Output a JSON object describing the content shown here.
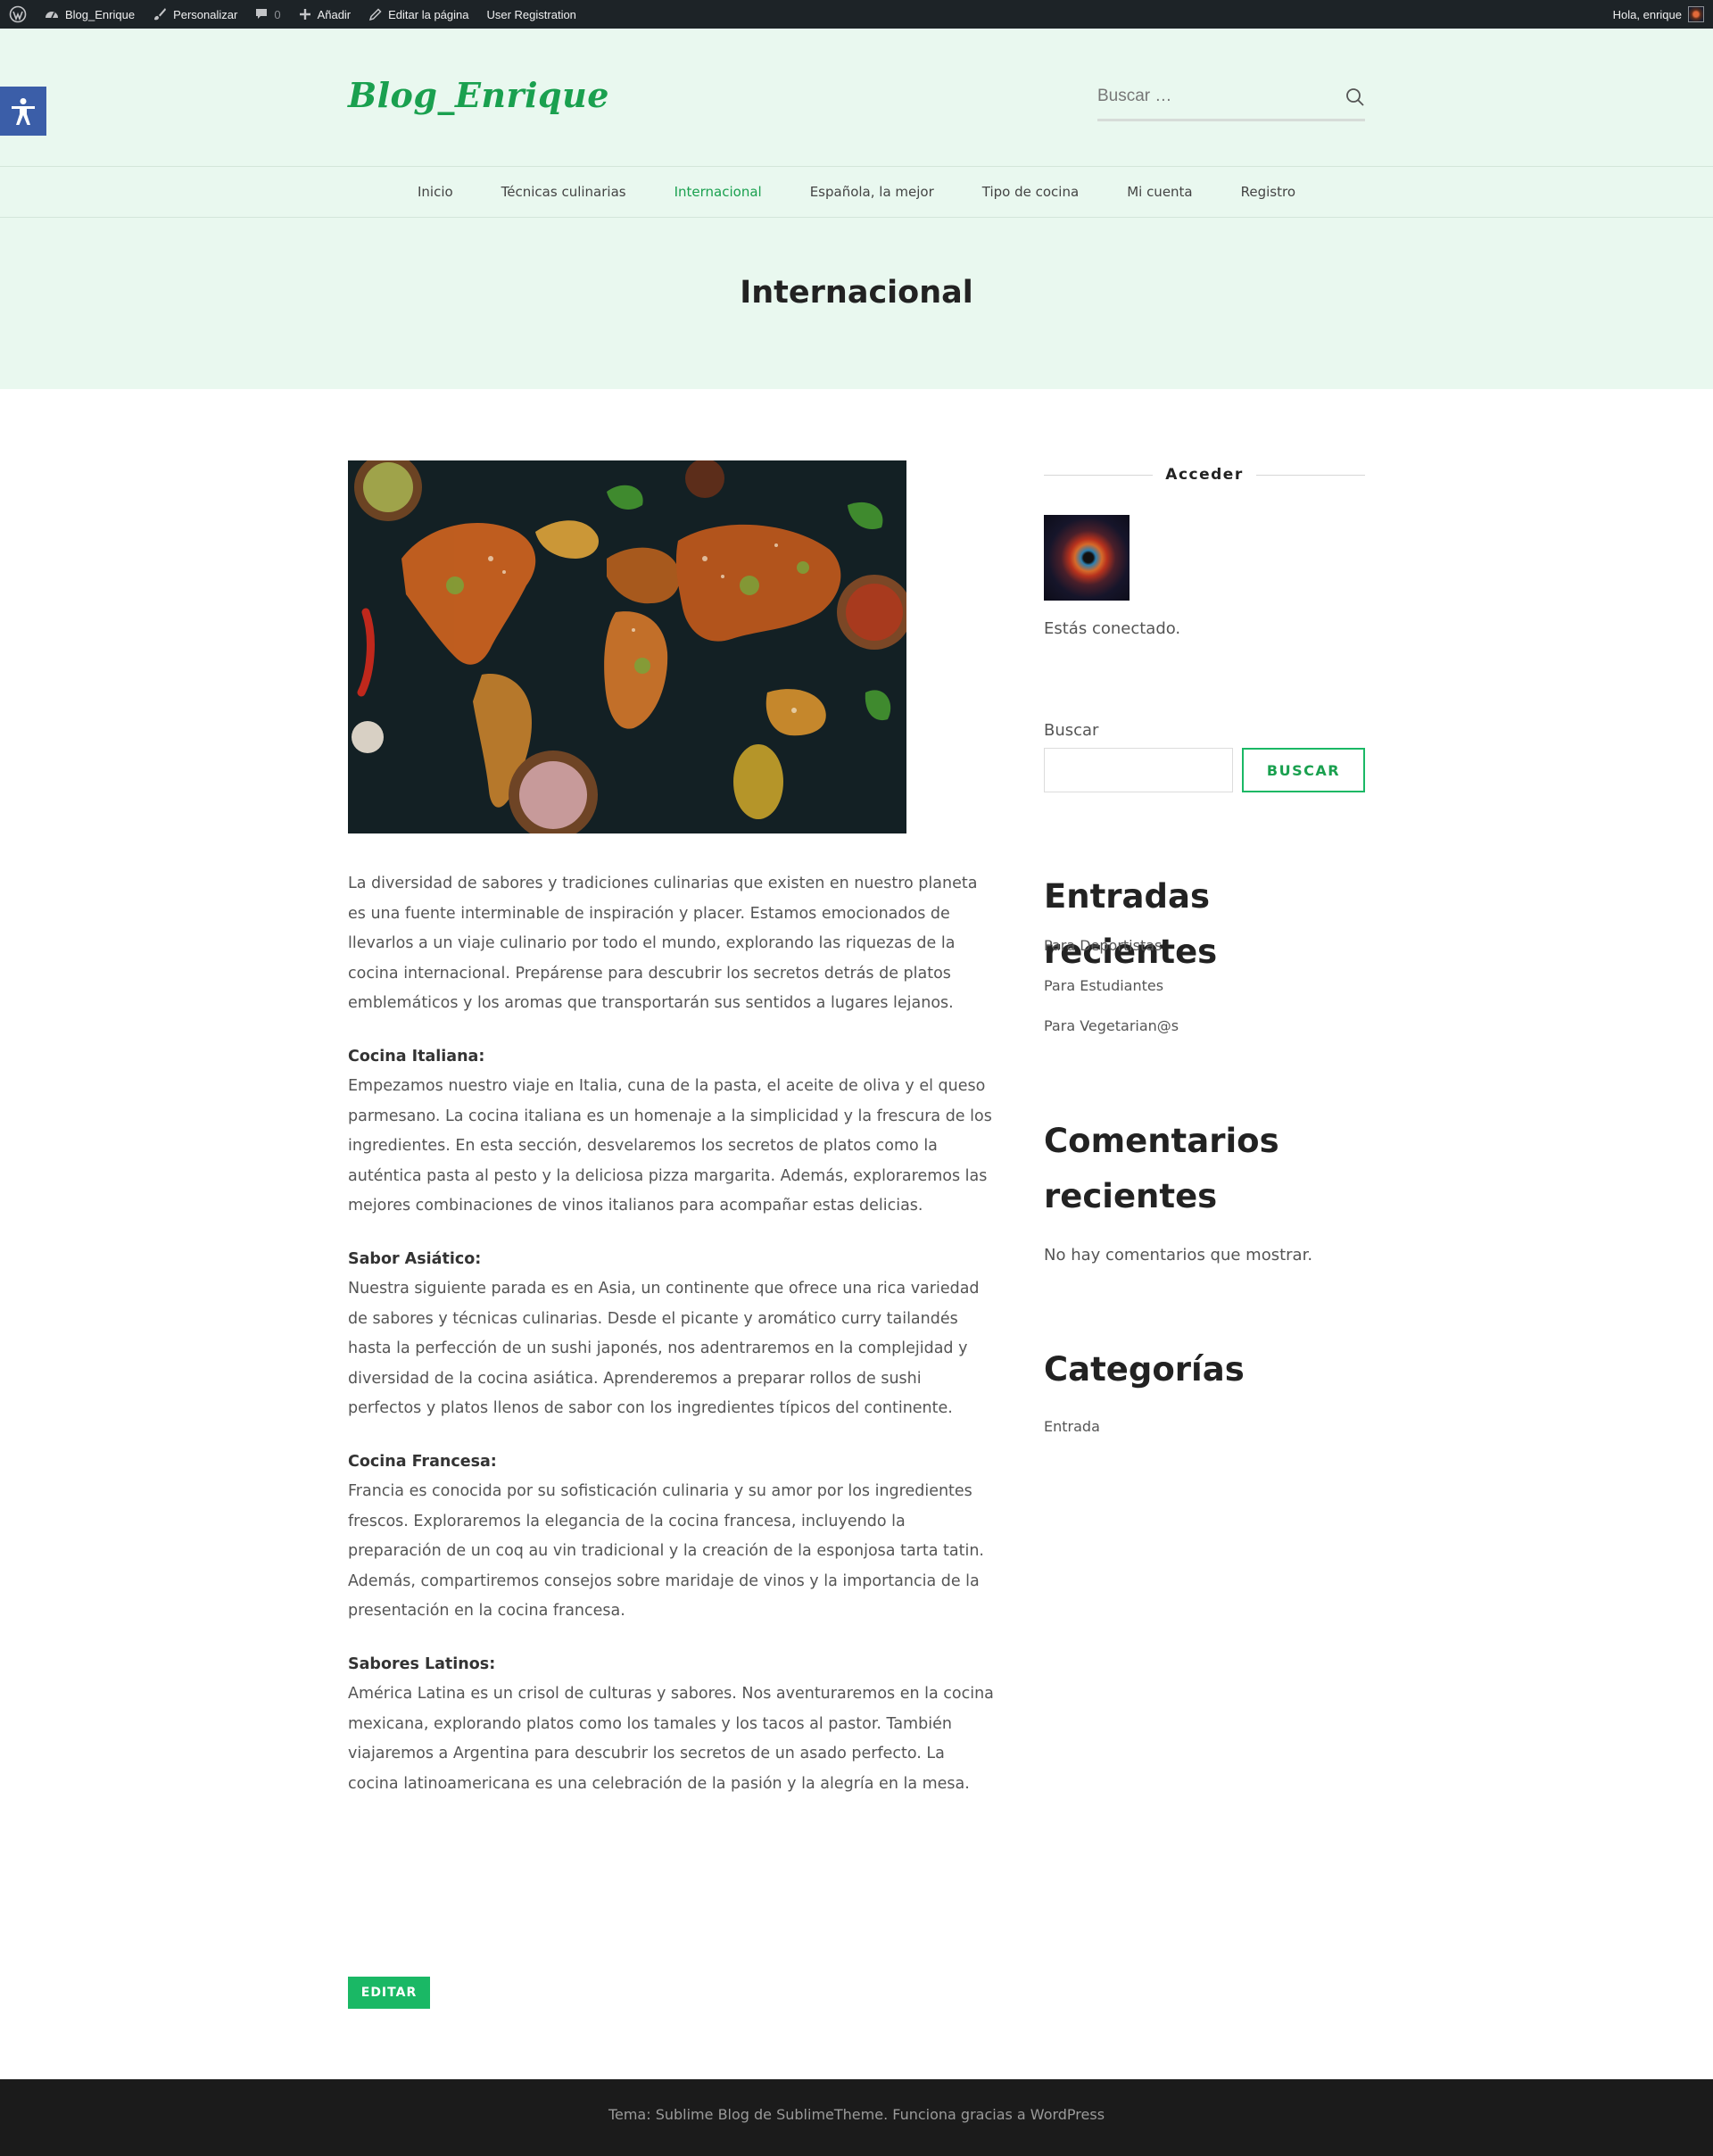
{
  "admin_bar": {
    "site_name": "Blog_Enrique",
    "customize": "Personalizar",
    "comments_count": "0",
    "add_new": "Añadir",
    "edit_page": "Editar la página",
    "user_registration": "User Registration",
    "greeting": "Hola, enrique"
  },
  "header": {
    "logo": "Blog_Enrique",
    "search_placeholder": "Buscar …"
  },
  "nav": {
    "items": [
      "Inicio",
      "Técnicas culinarias",
      "Internacional",
      "Española, la mejor",
      "Tipo de cocina",
      "Mi cuenta",
      "Registro"
    ],
    "active": "Internacional"
  },
  "page": {
    "title": "Internacional"
  },
  "content": {
    "intro": "La diversidad de sabores y tradiciones culinarias que existen en nuestro planeta es una fuente interminable de inspiración y placer. Estamos emocionados de llevarlos a un viaje culinario por todo el mundo, explorando las riquezas de la cocina internacional. Prepárense para descubrir los secretos detrás de platos emblemáticos y los aromas que transportarán sus sentidos a lugares lejanos.",
    "sections": [
      {
        "heading": "Cocina Italiana:",
        "text": "Empezamos nuestro viaje en Italia, cuna de la pasta, el aceite de oliva y el queso parmesano. La cocina italiana es un homenaje a la simplicidad y la frescura de los ingredientes. En esta sección, desvelaremos los secretos de platos como la auténtica pasta al pesto y la deliciosa pizza margarita. Además, exploraremos las mejores combinaciones de vinos italianos para acompañar estas delicias."
      },
      {
        "heading": "Sabor Asiático:",
        "text": "Nuestra siguiente parada es en Asia, un continente que ofrece una rica variedad de sabores y técnicas culinarias. Desde el picante y aromático curry tailandés hasta la perfección de un sushi japonés, nos adentraremos en la complejidad y diversidad de la cocina asiática. Aprenderemos a preparar rollos de sushi perfectos y platos llenos de sabor con los ingredientes típicos del continente."
      },
      {
        "heading": "Cocina Francesa:",
        "text": "Francia es conocida por su sofisticación culinaria y su amor por los ingredientes frescos. Exploraremos la elegancia de la cocina francesa, incluyendo la preparación de un coq au vin tradicional y la creación de la esponjosa tarta tatin. Además, compartiremos consejos sobre maridaje de vinos y la importancia de la presentación en la cocina francesa."
      },
      {
        "heading": "Sabores Latinos:",
        "text": "América Latina es un crisol de culturas y sabores. Nos aventuraremos en la cocina mexicana, explorando platos como los tamales y los tacos al pastor. También viajaremos a Argentina para descubrir los secretos de un asado perfecto. La cocina latinoamericana es una celebración de la pasión y la alegría en la mesa."
      }
    ],
    "edit_button": "EDITAR"
  },
  "sidebar": {
    "login_title": "Acceder",
    "login_status": "Estás conectado.",
    "search_label": "Buscar",
    "search_button": "BUSCAR",
    "recent_posts_title": "Entradas recientes",
    "recent_posts": [
      "Para Deportistas",
      "Para Estudiantes",
      "Para Vegetarian@s"
    ],
    "recent_comments_title_1": "Comentarios",
    "recent_comments_title_2": "recientes",
    "recent_comments_empty": "No hay comentarios que mostrar.",
    "categories_title": "Categorías",
    "categories": [
      "Entrada"
    ]
  },
  "footer": {
    "credit": "Tema: Sublime Blog de SublimeTheme. Funciona gracias a WordPress"
  },
  "colors": {
    "accent": "#1aa04f",
    "button": "#1ab865",
    "header_bg": "#e9f8ef",
    "admin_bar_bg": "#1d2327",
    "footer_bg": "#1b1b1b",
    "a11y_bg": "#3b5ea8"
  },
  "icons": [
    "wordpress-icon",
    "dashboard-icon",
    "brush-icon",
    "comment-icon",
    "plus-icon",
    "pencil-icon",
    "search-icon",
    "accessibility-icon"
  ]
}
